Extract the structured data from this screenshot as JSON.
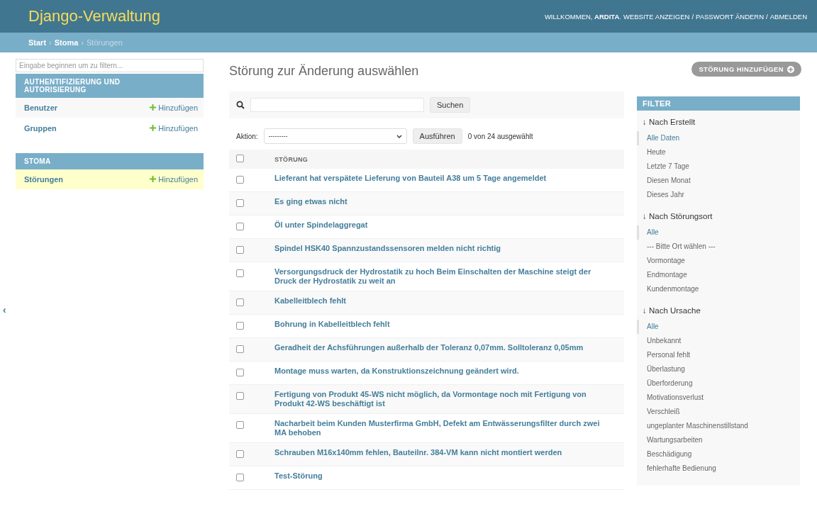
{
  "header": {
    "brand": "Django-Verwaltung",
    "welcome": "WILLKOMMEN, **ARDITA**.",
    "links": [
      "WEBSITE ANZEIGEN",
      "PASSWORT ÄNDERN",
      "ABMELDEN"
    ],
    "link_separator": "/"
  },
  "breadcrumb_separator": "›",
  "breadcrumbs": [
    {
      "label": "Start",
      "current": false
    },
    {
      "label": "Stoma",
      "current": false
    },
    {
      "label": "Störungen",
      "current": true
    }
  ],
  "sidebar": {
    "filter_placeholder": "Eingabe beginnen um zu filtern...",
    "nav_toggle": "‹",
    "modules": [
      {
        "title": "AUTHENTIFIZIERUNG UND AUTORISIERUNG",
        "models": [
          {
            "name": "Benutzer",
            "add": "Hinzufügen",
            "current": false
          },
          {
            "name": "Gruppen",
            "add": "Hinzufügen",
            "current": false
          }
        ]
      },
      {
        "title": "STOMA",
        "models": [
          {
            "name": "Störungen",
            "add": "Hinzufügen",
            "current": true
          }
        ]
      }
    ]
  },
  "content": {
    "title": "Störung zur Änderung auswählen",
    "add_button": "STÖRUNG HINZUFÜGEN",
    "search_button": "Suchen",
    "action_label": "Aktion:",
    "action_value": "---------",
    "run_button": "Ausführen",
    "counter": "0 von 24 ausgewählt",
    "table": {
      "column": "STÖRUNG",
      "header_checked": false,
      "rows": [
        {
          "text": "Lieferant hat verspätete Lieferung von Bauteil A38 um 5 Tage angemeldet",
          "checked": false
        },
        {
          "text": "Es ging etwas nicht",
          "checked": false
        },
        {
          "text": "Öl unter Spindelaggregat",
          "checked": false
        },
        {
          "text": "Spindel HSK40 Spannzustandssensoren melden nicht richtig",
          "checked": false
        },
        {
          "text": "Versorgungsdruck der Hydrostatik zu hoch Beim Einschalten der Maschine steigt der Druck der Hydrostatik zu weit an",
          "checked": false
        },
        {
          "text": "Kabelleitblech fehlt",
          "checked": false
        },
        {
          "text": "Bohrung in Kabelleitblech fehlt",
          "checked": false
        },
        {
          "text": "Geradheit der Achsführungen außerhalb der Toleranz 0,07mm. Solltoleranz 0,05mm",
          "checked": false
        },
        {
          "text": "Montage muss warten, da Konstruktionszeichnung geändert wird.",
          "checked": false
        },
        {
          "text": "Fertigung von Produkt 45-WS nicht möglich, da Vormontage noch mit Fertigung von Produkt 42-WS beschäftigt ist",
          "checked": false
        },
        {
          "text": "Nacharbeit beim Kunden Musterfirma GmbH, Defekt am Entwässerungsfilter durch zwei MA behoben",
          "checked": false
        },
        {
          "text": "Schrauben M16x140mm fehlen, Bauteilnr. 384-VM kann nicht montiert werden",
          "checked": false
        },
        {
          "text": "Test-Störung",
          "checked": false
        }
      ]
    }
  },
  "filter": {
    "title": "FILTER",
    "groups": [
      {
        "heading": "↓ Nach Erstellt",
        "options": [
          {
            "label": "Alle Daten",
            "selected": true
          },
          {
            "label": "Heute",
            "selected": false
          },
          {
            "label": "Letzte 7 Tage",
            "selected": false
          },
          {
            "label": "Diesen Monat",
            "selected": false
          },
          {
            "label": "Dieses Jahr",
            "selected": false
          }
        ]
      },
      {
        "heading": "↓ Nach Störungsort",
        "options": [
          {
            "label": "Alle",
            "selected": true
          },
          {
            "label": "--- Bitte Ort wählen ---",
            "selected": false
          },
          {
            "label": "Vormontage",
            "selected": false
          },
          {
            "label": "Endmontage",
            "selected": false
          },
          {
            "label": "Kundenmontage",
            "selected": false
          }
        ]
      },
      {
        "heading": "↓ Nach Ursache",
        "options": [
          {
            "label": "Alle",
            "selected": true
          },
          {
            "label": "Unbekannt",
            "selected": false
          },
          {
            "label": "Personal fehlt",
            "selected": false
          },
          {
            "label": "Überlastung",
            "selected": false
          },
          {
            "label": "Überforderung",
            "selected": false
          },
          {
            "label": "Motivationsverlust",
            "selected": false
          },
          {
            "label": "Verschleiß",
            "selected": false
          },
          {
            "label": "ungeplanter Maschinenstillstand",
            "selected": false
          },
          {
            "label": "Wartungsarbeiten",
            "selected": false
          },
          {
            "label": "Beschädigung",
            "selected": false
          },
          {
            "label": "fehlerhafte Bedienung",
            "selected": false
          }
        ]
      }
    ]
  }
}
